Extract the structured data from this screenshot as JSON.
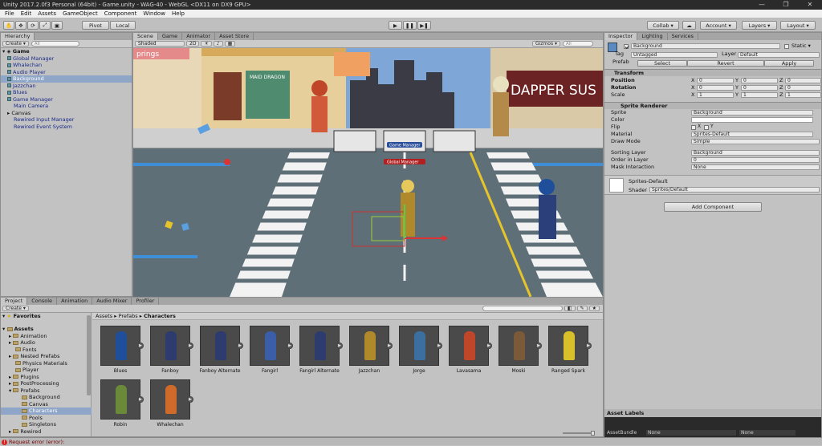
{
  "window": {
    "title": "Unity 2017.2.0f3 Personal (64bit) - Game.unity - WAG-40 - WebGL <DX11 on DX9 GPU>",
    "minimize": "—",
    "maximize": "❐",
    "close": "✕"
  },
  "menu": [
    "File",
    "Edit",
    "Assets",
    "GameObject",
    "Component",
    "Window",
    "Help"
  ],
  "toolbar": {
    "pivot": "Pivot",
    "local": "Local",
    "collab": "Collab ▾",
    "account": "Account ▾",
    "layers": "Layers ▾",
    "layout": "Layout ▾"
  },
  "hierarchy": {
    "tab": "Hierarchy",
    "create": "Create ▾",
    "search": "All",
    "scene": "Game",
    "items": [
      {
        "label": "Global Manager"
      },
      {
        "label": "Whalechan"
      },
      {
        "label": "Audio Player"
      },
      {
        "label": "Background"
      },
      {
        "label": "Jazzchan"
      },
      {
        "label": "Blues"
      },
      {
        "label": "Game Manager"
      },
      {
        "label": "Main Camera"
      },
      {
        "label": "Canvas"
      },
      {
        "label": "Rewired Input Manager"
      },
      {
        "label": "Rewired Event System"
      }
    ]
  },
  "scene": {
    "tabs": [
      "Scene",
      "Game",
      "Animator",
      "Asset Store"
    ],
    "shading": "Shaded",
    "mode2d": "2D",
    "gizmos": "Gizmos ▾",
    "search": "All",
    "labels": {
      "game_manager": "Game Manager",
      "global_manager": "Global Manager",
      "sign_left": "prings",
      "sign_dragon": "MAID DRAGON",
      "sign_dapper": "DAPPER SUS"
    }
  },
  "inspector": {
    "tabs": [
      "Inspector",
      "Lighting",
      "Services"
    ],
    "object_name": "Background",
    "static": "Static ▾",
    "tag_label": "Tag",
    "tag_value": "Untagged",
    "layer_label": "Layer",
    "layer_value": "Default",
    "prefab_label": "Prefab",
    "prefab_buttons": [
      "Select",
      "Revert",
      "Apply"
    ],
    "transform": {
      "title": "Transform",
      "rows": [
        {
          "label": "Position",
          "x": "0",
          "y": "0",
          "z": "0"
        },
        {
          "label": "Rotation",
          "x": "0",
          "y": "0",
          "z": "0"
        },
        {
          "label": "Scale",
          "x": "1",
          "y": "1",
          "z": "1"
        }
      ]
    },
    "sprite_renderer": {
      "title": "Sprite Renderer",
      "sprite_label": "Sprite",
      "sprite_value": "Background",
      "color_label": "Color",
      "flip_label": "Flip",
      "flip_x": "X",
      "flip_y": "Y",
      "material_label": "Material",
      "material_value": "Sprites-Default",
      "draw_mode_label": "Draw Mode",
      "draw_mode_value": "Simple",
      "sorting_layer_label": "Sorting Layer",
      "sorting_layer_value": "Background",
      "order_label": "Order in Layer",
      "order_value": "0",
      "mask_label": "Mask Interaction",
      "mask_value": "None"
    },
    "material_block": {
      "name": "Sprites-Default",
      "shader_label": "Shader",
      "shader_value": "Sprites/Default"
    },
    "add_component": "Add Component",
    "asset_labels": "Asset Labels",
    "asset_bundle_label": "AssetBundle",
    "asset_bundle_value": "None",
    "asset_bundle_variant": "None"
  },
  "project": {
    "tabs": [
      "Project",
      "Console",
      "Animation",
      "Audio Mixer",
      "Profiler"
    ],
    "create": "Create ▾",
    "favorites": "Favorites",
    "assets": "Assets",
    "tree": [
      {
        "label": "Animation",
        "indent": 1
      },
      {
        "label": "Audio",
        "indent": 1
      },
      {
        "label": "Fonts",
        "indent": 1
      },
      {
        "label": "Nested Prefabs",
        "indent": 1
      },
      {
        "label": "Physics Materials",
        "indent": 1
      },
      {
        "label": "Player",
        "indent": 1
      },
      {
        "label": "Plugins",
        "indent": 1
      },
      {
        "label": "PostProcessing",
        "indent": 1
      },
      {
        "label": "Prefabs",
        "indent": 1
      },
      {
        "label": "Background",
        "indent": 2
      },
      {
        "label": "Canvas",
        "indent": 2
      },
      {
        "label": "Characters",
        "indent": 2
      },
      {
        "label": "Pools",
        "indent": 2
      },
      {
        "label": "Singletons",
        "indent": 2
      },
      {
        "label": "Rewired",
        "indent": 1
      }
    ],
    "breadcrumb": [
      "Assets",
      "Prefabs",
      "Characters"
    ],
    "items": [
      "Blues",
      "Fanboy",
      "Fanboy Alternate",
      "Fangirl",
      "Fangirl Alternate",
      "Jazzchan",
      "Jorge",
      "Lavasama",
      "Moski",
      "Ranged Spark",
      "Robin",
      "Whalechan"
    ],
    "thumb_colors": [
      "#1f4f9a",
      "#2d3b6e",
      "#2d3b6e",
      "#3a5fa8",
      "#2d3b6e",
      "#b08a2a",
      "#3d6ea0",
      "#c0462a",
      "#7b5a3a",
      "#d8c02a",
      "#6a8a3a",
      "#d06a2a"
    ]
  },
  "status": {
    "message": "Request error (error):"
  }
}
